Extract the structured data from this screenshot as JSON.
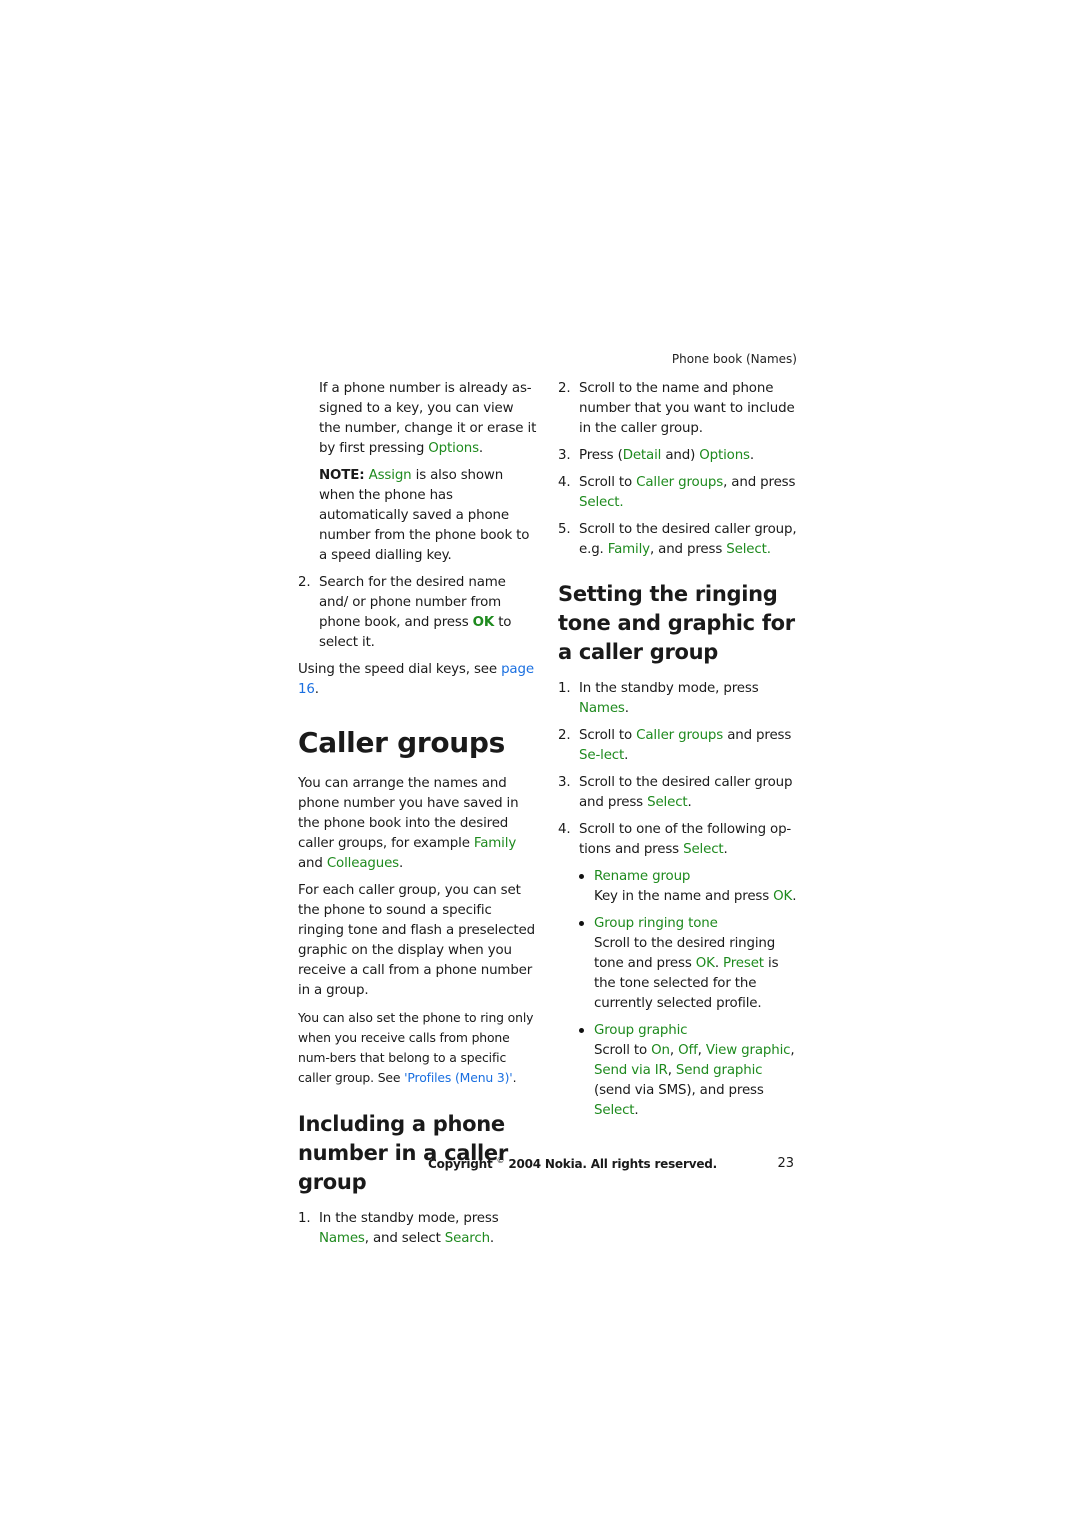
{
  "running_head": "Phone book (Names)",
  "left_column": {
    "intro_para": {
      "text_before": "If a phone number is already as-signed to a key, you can view the number, change it or erase it by first pressing ",
      "link": "Options",
      "text_after": "."
    },
    "note": {
      "label": "NOTE:",
      "link": "Assign",
      "text_after": " is also shown when the phone has automatically saved a phone number from the phone book to a speed dialling key."
    },
    "step2": {
      "num": "2.",
      "text_before": "Search for the desired name and/ or phone number from phone book, and press ",
      "link": "OK",
      "text_after": " to select it."
    },
    "speed_dial_ref": {
      "text_before": "Using the speed dial keys, see ",
      "link": "page 16",
      "text_after": "."
    },
    "caller_groups": {
      "title": "Caller groups",
      "para1": {
        "text_before": "You can arrange the names and phone number you have saved in the phone book into the desired caller groups, for example ",
        "link1": "Family",
        "mid": " and ",
        "link2": "Colleagues",
        "text_after": "."
      },
      "para2": "For each caller group, you can set the phone to sound a specific ringing tone and flash a preselected graphic on the display when you receive a call from a phone number in a group.",
      "para3": {
        "text_before": "You can also set the phone to ring only when you receive calls from phone num-bers that belong to a specific caller group. See ",
        "link": "'Profiles (Menu 3)'",
        "text_after": "."
      }
    },
    "including": {
      "title": "Including a phone number in a caller group",
      "step1": {
        "num": "1.",
        "text_before": "In the standby mode, press ",
        "link1": "Names",
        "mid": ", and select ",
        "link2": "Search",
        "text_after": "."
      }
    }
  },
  "right_column": {
    "step2": {
      "num": "2.",
      "text": "Scroll to the name and phone number that you want to include in the caller group."
    },
    "step3": {
      "num": "3.",
      "text_before": "Press (",
      "link1": "Detail",
      "mid": " and) ",
      "link2": "Options",
      "text_after": "."
    },
    "step4": {
      "num": "4.",
      "text_before": "Scroll to ",
      "link1": "Caller groups",
      "mid": ", and press ",
      "link2": "Select.",
      "text_after": ""
    },
    "step5": {
      "num": "5.",
      "text_before": "Scroll to the desired caller group, e.g. ",
      "link1": "Family",
      "mid": ", and press ",
      "link2": "Select.",
      "text_after": ""
    },
    "setting": {
      "title": "Setting the ringing tone and graphic for a caller group",
      "step1": {
        "num": "1.",
        "text_before": "In the standby mode, press ",
        "link": "Names",
        "text_after": "."
      },
      "step2": {
        "num": "2.",
        "text_before": "Scroll to ",
        "link1": "Caller groups",
        "mid": " and press ",
        "link2": "Se-lect",
        "text_after": "."
      },
      "step3": {
        "num": "3.",
        "text_before": "Scroll to the desired caller group and press ",
        "link": "Select",
        "text_after": "."
      },
      "step4": {
        "num": "4.",
        "text_before": "Scroll to one of the following op-tions and press ",
        "link": "Select",
        "text_after": "."
      },
      "options": [
        {
          "name": "Rename group",
          "desc_before": "Key in the name and press ",
          "desc_link": "OK",
          "desc_after": "."
        },
        {
          "name": "Group ringing tone",
          "desc_before": "Scroll to the desired ringing tone and press ",
          "desc_link": "OK",
          "desc_mid": ". ",
          "desc_link2": "Preset",
          "desc_after": " is the tone selected for the currently selected profile."
        },
        {
          "name": "Group graphic",
          "desc_before": "Scroll to ",
          "links": [
            "On",
            "Off",
            "View graphic",
            "Send via IR",
            "Send graphic"
          ],
          "sep": ", ",
          "desc_mid": " (send via SMS), and press ",
          "desc_link": "Select",
          "desc_after": "."
        }
      ]
    }
  },
  "footer": {
    "copyright_before": "Copyright ",
    "copyright_symbol": "©",
    "copyright_after": " 2004 Nokia. All rights reserved.",
    "page_number": "23"
  },
  "colors": {
    "menu_green": "#1e8a1e",
    "link_blue": "#1a6fe0",
    "text": "#1a1a1a"
  }
}
